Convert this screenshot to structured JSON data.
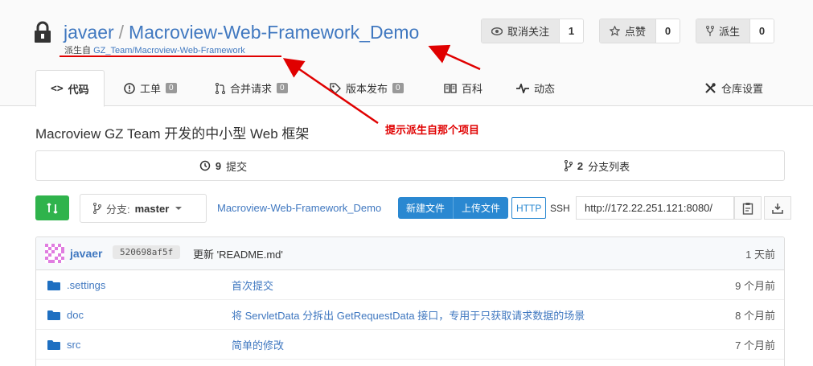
{
  "repo": {
    "owner": "javaer",
    "separator": "/",
    "name": "Macroview-Web-Framework_Demo",
    "forked_prefix": "派生自",
    "forked_from": "GZ_Team/Macroview-Web-Framework",
    "description": "Macroview GZ Team 开发的中小型 Web 框架"
  },
  "actions": [
    {
      "label": "取消关注",
      "count": "1",
      "icon": "eye-icon"
    },
    {
      "label": "点赞",
      "count": "0",
      "icon": "star-icon"
    },
    {
      "label": "派生",
      "count": "0",
      "icon": "fork-icon"
    }
  ],
  "tabs": {
    "code": "代码",
    "issues": "工单",
    "issues_count": "0",
    "pulls": "合并请求",
    "pulls_count": "0",
    "releases": "版本发布",
    "releases_count": "0",
    "wiki": "百科",
    "activity": "动态",
    "settings": "仓库设置"
  },
  "annotation": "提示派生自那个项目",
  "stats": {
    "commits_count": "9",
    "commits_label": "提交",
    "branches_count": "2",
    "branches_label": "分支列表"
  },
  "toolbar": {
    "branch_prefix": "分支:",
    "branch_name": "master",
    "repo_link": "Macroview-Web-Framework_Demo",
    "new_file": "新建文件",
    "upload_file": "上传文件",
    "http": "HTTP",
    "ssh": "SSH",
    "clone_url": "http://172.22.251.121:8080/"
  },
  "latest_commit": {
    "author": "javaer",
    "sha": "520698af5f",
    "message": "更新 'README.md'",
    "time": "1 天前"
  },
  "files": [
    {
      "name": ".settings",
      "message": "首次提交",
      "time": "9 个月前"
    },
    {
      "name": "doc",
      "message": "将 ServletData 分拆出 GetRequestData 接口，专用于只获取请求数据的场景",
      "time": "8 个月前"
    },
    {
      "name": "src",
      "message": "简单的修改",
      "time": "7 个月前"
    }
  ],
  "colors": {
    "link": "#4078c0",
    "annotation_red": "#e00000",
    "sync_green": "#2fb34c",
    "primary_blue": "#2a88d1"
  }
}
